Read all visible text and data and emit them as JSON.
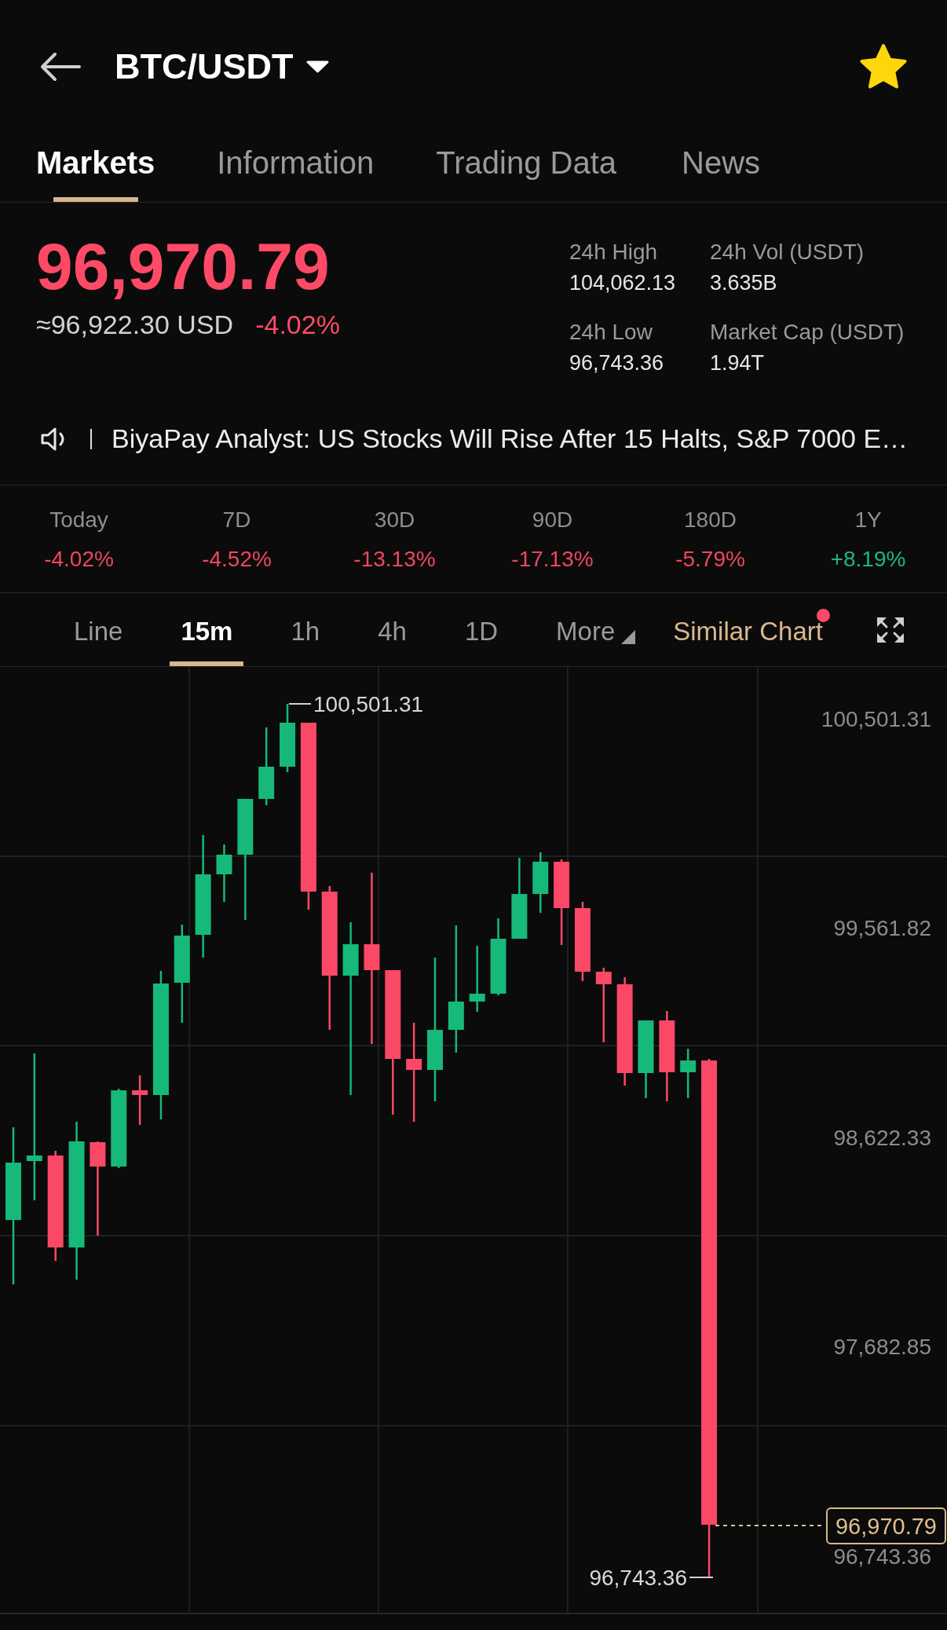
{
  "header": {
    "title": "BTC/USDT",
    "favorited": true
  },
  "tabs": [
    {
      "label": "Markets",
      "selected": true
    },
    {
      "label": "Information",
      "selected": false
    },
    {
      "label": "Trading Data",
      "selected": false
    },
    {
      "label": "News",
      "selected": false
    }
  ],
  "price": {
    "last": "96,970.79",
    "converted": "≈96,922.30 USD",
    "change": "-4.02%"
  },
  "stats": [
    {
      "label": "24h High",
      "value": "104,062.13"
    },
    {
      "label": "24h Vol (USDT)",
      "value": "3.635B"
    },
    {
      "label": "24h Low",
      "value": "96,743.36"
    },
    {
      "label": "Market Cap (USDT)",
      "value": "1.94T"
    }
  ],
  "news_ticker": {
    "text": "BiyaPay Analyst: US Stocks Will Rise After 15 Halts, S&P 7000 E…"
  },
  "performance": [
    {
      "period": "Today",
      "change": "-4.02%",
      "color": "#f0465f"
    },
    {
      "period": "7D",
      "change": "-4.52%",
      "color": "#f0465f"
    },
    {
      "period": "30D",
      "change": "-13.13%",
      "color": "#f0465f"
    },
    {
      "period": "90D",
      "change": "-17.13%",
      "color": "#f0465f"
    },
    {
      "period": "180D",
      "change": "-5.79%",
      "color": "#f0465f"
    },
    {
      "period": "1Y",
      "change": "+8.19%",
      "color": "#1db87a"
    }
  ],
  "intervals": [
    {
      "label": "Line",
      "kind": "option",
      "selected": false
    },
    {
      "label": "15m",
      "kind": "option",
      "selected": true
    },
    {
      "label": "1h",
      "kind": "option",
      "selected": false
    },
    {
      "label": "4h",
      "kind": "option",
      "selected": false
    },
    {
      "label": "1D",
      "kind": "option",
      "selected": false
    },
    {
      "label": "More",
      "kind": "menu",
      "selected": false
    }
  ],
  "similar_chart": {
    "label": "Similar Chart",
    "notification": true
  },
  "chart": {
    "y_axis_labels": [
      "100,501.31",
      "99,561.82",
      "98,622.33",
      "97,682.85",
      "96,743.36"
    ],
    "high_label": "100,501.31",
    "low_label": "96,743.36",
    "last_price_tag": "96,970.79"
  }
}
